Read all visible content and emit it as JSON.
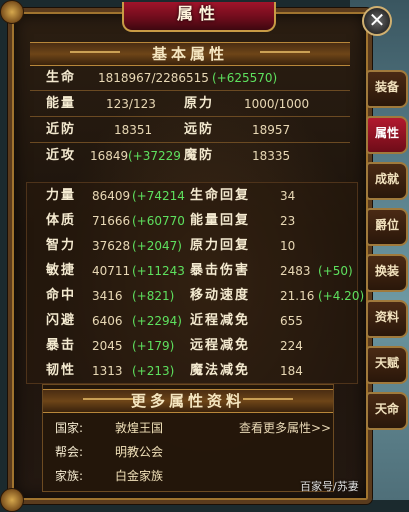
{
  "window": {
    "title": "属性",
    "close": "✕"
  },
  "basic": {
    "header": "基本属性",
    "life_label": "生命",
    "life_value": "1818967/2286515",
    "life_bonus": "(+625570)",
    "energy_label": "能量",
    "energy_value": "123/123",
    "power_label": "原力",
    "power_value": "1000/1000",
    "melee_def_label": "近防",
    "melee_def_value": "18351",
    "ranged_def_label": "远防",
    "ranged_def_value": "18957",
    "melee_atk_label": "近攻",
    "melee_atk_value": "16849",
    "melee_atk_bonus": "(+37229",
    "magic_def_label": "魔防",
    "magic_def_value": "18335"
  },
  "stats": [
    {
      "l1": "力量",
      "v1": "86409",
      "b1": "(+74214",
      "l2": "生命回复",
      "v2": "34",
      "b2": ""
    },
    {
      "l1": "体质",
      "v1": "71666",
      "b1": "(+60770",
      "l2": "能量回复",
      "v2": "23",
      "b2": ""
    },
    {
      "l1": "智力",
      "v1": "37628",
      "b1": "(+2047)",
      "l2": "原力回复",
      "v2": "10",
      "b2": ""
    },
    {
      "l1": "敏捷",
      "v1": "40711",
      "b1": "(+11243",
      "l2": "暴击伤害",
      "v2": "2483",
      "b2": "(+50)"
    },
    {
      "l1": "命中",
      "v1": "3416",
      "b1": "(+821)",
      "l2": "移动速度",
      "v2": "21.16",
      "b2": "(+4.20)"
    },
    {
      "l1": "闪避",
      "v1": "6406",
      "b1": "(+2294)",
      "l2": "近程减免",
      "v2": "655",
      "b2": ""
    },
    {
      "l1": "暴击",
      "v1": "2045",
      "b1": "(+179)",
      "l2": "远程减免",
      "v2": "224",
      "b2": ""
    },
    {
      "l1": "韧性",
      "v1": "1313",
      "b1": "(+213)",
      "l2": "魔法减免",
      "v2": "184",
      "b2": ""
    }
  ],
  "more": {
    "header": "更多属性资料",
    "country_label": "国家:",
    "country_value": "敦煌王国",
    "more_link": "查看更多属性>>",
    "guild_label": "帮会:",
    "guild_value": "明教公会",
    "family_label": "家族:",
    "family_value": "白金家族"
  },
  "tabs": [
    "装备",
    "属性",
    "成就",
    "爵位",
    "换装",
    "资料",
    "天赋",
    "天命"
  ],
  "active_tab": "属性",
  "watermark": "百家号/苏妻"
}
